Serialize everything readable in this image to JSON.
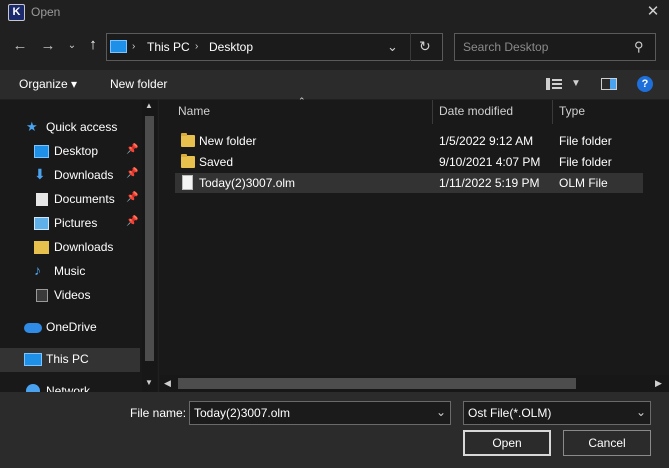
{
  "window": {
    "title": "Open",
    "app_icon_letter": "K"
  },
  "nav": {
    "back_icon": "arrow-left-icon",
    "forward_icon": "arrow-right-icon",
    "up_icon": "arrow-up-icon",
    "breadcrumb": [
      "This PC",
      "Desktop"
    ],
    "search_placeholder": "Search Desktop"
  },
  "toolbar": {
    "organize_label": "Organize ▾",
    "new_folder_label": "New folder"
  },
  "sidebar": {
    "items": [
      {
        "label": "Quick access",
        "icon": "star-icon",
        "pinned": false
      },
      {
        "label": "Desktop",
        "icon": "desktop-icon",
        "pinned": true
      },
      {
        "label": "Downloads",
        "icon": "download-icon",
        "pinned": true
      },
      {
        "label": "Documents",
        "icon": "documents-icon",
        "pinned": true
      },
      {
        "label": "Pictures",
        "icon": "pictures-icon",
        "pinned": true
      },
      {
        "label": "Downloads",
        "icon": "folder-icon",
        "pinned": false
      },
      {
        "label": "Music",
        "icon": "music-icon",
        "pinned": false
      },
      {
        "label": "Videos",
        "icon": "videos-icon",
        "pinned": false
      },
      {
        "label": "OneDrive",
        "icon": "cloud-icon",
        "pinned": false
      },
      {
        "label": "This PC",
        "icon": "pc-icon",
        "pinned": false
      },
      {
        "label": "Network",
        "icon": "network-icon",
        "pinned": false
      }
    ]
  },
  "file_list": {
    "columns": [
      "Name",
      "Date modified",
      "Type"
    ],
    "rows": [
      {
        "name": "New folder",
        "date": "1/5/2022 9:12 AM",
        "type": "File folder",
        "kind": "folder"
      },
      {
        "name": "Saved",
        "date": "9/10/2021 4:07 PM",
        "type": "File folder",
        "kind": "folder"
      },
      {
        "name": "Today(2)3007.olm",
        "date": "1/11/2022 5:19 PM",
        "type": "OLM File",
        "kind": "file"
      }
    ]
  },
  "footer": {
    "file_name_label": "File name:",
    "file_name_value": "Today(2)3007.olm",
    "filter_value": "Ost File(*.OLM)",
    "open_label": "Open",
    "cancel_label": "Cancel"
  },
  "colors": {
    "background": "#202020",
    "pane": "#191919",
    "toolbar": "#2b2b2b",
    "selected_row": "#333333",
    "accent": "#0078d4"
  }
}
